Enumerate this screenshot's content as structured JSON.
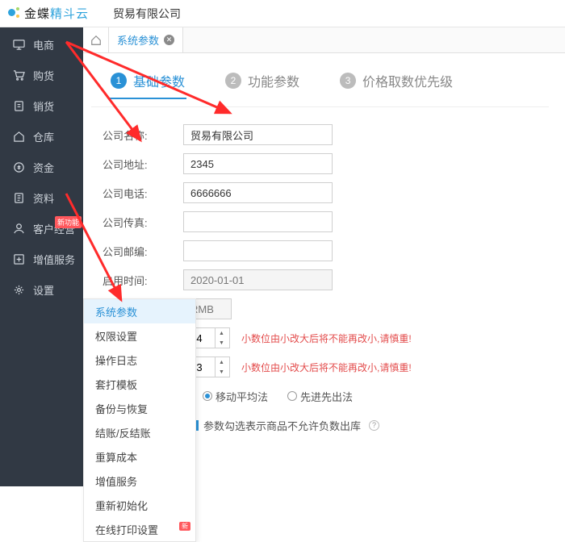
{
  "brand": {
    "a": "金蝶",
    "b": "精斗云"
  },
  "company": "贸易有限公司",
  "sidebar": {
    "items": [
      {
        "label": "电商"
      },
      {
        "label": "购货"
      },
      {
        "label": "销货"
      },
      {
        "label": "仓库"
      },
      {
        "label": "资金"
      },
      {
        "label": "资料"
      },
      {
        "label": "客户经营",
        "badge": "新功能"
      },
      {
        "label": "增值服务"
      },
      {
        "label": "设置"
      }
    ]
  },
  "tabs": {
    "active": "系统参数"
  },
  "steps": [
    {
      "num": "1",
      "label": "基础参数"
    },
    {
      "num": "2",
      "label": "功能参数"
    },
    {
      "num": "3",
      "label": "价格取数优先级"
    }
  ],
  "form": {
    "company_name": {
      "label": "公司名称:",
      "value": "贸易有限公司"
    },
    "company_addr": {
      "label": "公司地址:",
      "value": "2345"
    },
    "company_tel": {
      "label": "公司电话:",
      "value": "6666666"
    },
    "company_fax": {
      "label": "公司传真:",
      "value": ""
    },
    "company_zip": {
      "label": "公司邮编:",
      "value": ""
    },
    "enable_time": {
      "label": "启用时间:",
      "value": "2020-01-01"
    },
    "currency": {
      "value": "RMB"
    },
    "spin1": {
      "value": "4"
    },
    "spin2": {
      "value": "3"
    },
    "warn": "小数位由小改大后将不能再改小,请慎重!",
    "radio": {
      "opt1": "移动平均法",
      "opt2": "先进先出法"
    },
    "check": {
      "label": "参数勾选表示商品不允许负数出库"
    }
  },
  "submenu": {
    "items": [
      {
        "label": "系统参数",
        "hl": true
      },
      {
        "label": "权限设置"
      },
      {
        "label": "操作日志"
      },
      {
        "label": "套打模板"
      },
      {
        "label": "备份与恢复"
      },
      {
        "label": "结账/反结账"
      },
      {
        "label": "重算成本"
      },
      {
        "label": "增值服务"
      },
      {
        "label": "重新初始化"
      },
      {
        "label": "在线打印设置",
        "badge": "新"
      }
    ]
  }
}
